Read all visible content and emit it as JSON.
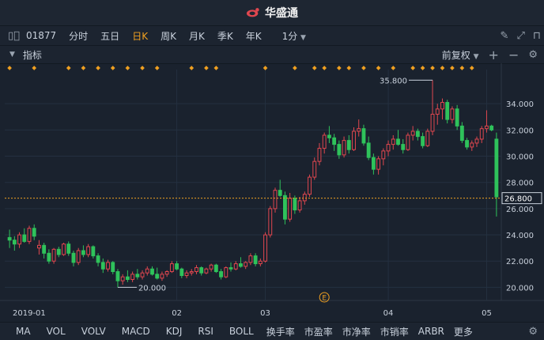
{
  "app": {
    "title": "华盛通"
  },
  "toolbar": {
    "stock_code": "01877",
    "periods": [
      "分时",
      "五日",
      "日K",
      "周K",
      "月K",
      "季K",
      "年K"
    ],
    "active_period": "日K",
    "interval": "1分",
    "icons": [
      "edit-icon",
      "fullscreen-icon",
      "layout-icon"
    ]
  },
  "indicator_bar": {
    "label": "指标",
    "adjust": "前复权",
    "add_icon": "plus-icon",
    "minus_icon": "minus-icon",
    "settings_icon": "gear-icon"
  },
  "bottom_tabs": [
    "MA",
    "VOL",
    "VOLV",
    "MACD",
    "KDJ",
    "RSI",
    "BOLL",
    "换手率",
    "市盈率",
    "市净率",
    "市销率",
    "ARBR",
    "更多"
  ],
  "colors": {
    "up": "#e0474f",
    "down": "#2fc25b",
    "marker": "#f0a020",
    "background": "#1a222e",
    "current_line": "#f0a020"
  },
  "chart_data": {
    "type": "candlestick",
    "x_labels": [
      "2019-01",
      "02",
      "03",
      "04",
      "05"
    ],
    "y_ticks": [
      20.0,
      22.0,
      24.0,
      26.0,
      28.0,
      30.0,
      32.0,
      34.0
    ],
    "ylim": [
      19.0,
      36.0
    ],
    "current_price": "26.800",
    "high_label": "35.800",
    "low_label": "20.000",
    "event_marker": "E",
    "candles": [
      [
        23.8,
        24.4,
        23.0,
        23.6
      ],
      [
        23.6,
        23.9,
        22.8,
        23.3
      ],
      [
        23.3,
        24.2,
        23.0,
        24.0
      ],
      [
        24.0,
        24.5,
        23.4,
        23.5
      ],
      [
        23.5,
        24.7,
        23.3,
        24.5
      ],
      [
        24.5,
        24.8,
        23.6,
        23.9
      ],
      [
        23.0,
        23.6,
        22.5,
        23.2
      ],
      [
        23.2,
        23.4,
        22.2,
        22.6
      ],
      [
        22.6,
        22.9,
        21.8,
        22.0
      ],
      [
        22.0,
        23.0,
        21.8,
        22.9
      ],
      [
        22.9,
        23.1,
        22.3,
        22.5
      ],
      [
        22.5,
        23.4,
        22.4,
        23.3
      ],
      [
        23.3,
        23.5,
        22.4,
        22.6
      ],
      [
        22.6,
        22.8,
        21.6,
        21.9
      ],
      [
        21.9,
        23.0,
        21.7,
        22.8
      ],
      [
        22.8,
        23.2,
        22.3,
        22.5
      ],
      [
        22.5,
        23.3,
        22.3,
        23.1
      ],
      [
        23.1,
        23.2,
        22.2,
        22.4
      ],
      [
        22.4,
        22.6,
        21.6,
        21.9
      ],
      [
        21.9,
        22.2,
        21.1,
        21.4
      ],
      [
        21.4,
        22.1,
        21.2,
        21.9
      ],
      [
        21.9,
        22.0,
        21.0,
        21.2
      ],
      [
        21.2,
        21.4,
        20.0,
        20.5
      ],
      [
        20.5,
        21.0,
        20.2,
        20.8
      ],
      [
        20.8,
        21.3,
        20.4,
        20.6
      ],
      [
        20.6,
        21.2,
        20.4,
        21.0
      ],
      [
        21.0,
        21.4,
        20.6,
        20.8
      ],
      [
        20.8,
        21.3,
        20.6,
        21.1
      ],
      [
        21.1,
        21.6,
        20.9,
        21.4
      ],
      [
        21.4,
        21.6,
        20.9,
        21.0
      ],
      [
        21.0,
        21.5,
        20.6,
        20.7
      ],
      [
        20.7,
        21.2,
        20.5,
        21.0
      ],
      [
        21.0,
        21.3,
        20.8,
        21.2
      ],
      [
        21.2,
        22.0,
        21.1,
        21.8
      ],
      [
        21.8,
        22.0,
        21.3,
        21.4
      ],
      [
        21.4,
        21.5,
        20.7,
        20.9
      ],
      [
        20.9,
        21.3,
        20.7,
        21.1
      ],
      [
        21.1,
        21.4,
        20.9,
        21.2
      ],
      [
        21.2,
        21.7,
        21.0,
        21.5
      ],
      [
        21.5,
        21.6,
        20.9,
        21.1
      ],
      [
        21.1,
        21.5,
        21.0,
        21.4
      ],
      [
        21.4,
        21.8,
        21.2,
        21.7
      ],
      [
        21.7,
        21.8,
        21.1,
        21.2
      ],
      [
        21.2,
        21.4,
        20.6,
        20.8
      ],
      [
        20.8,
        21.6,
        20.7,
        21.5
      ],
      [
        21.5,
        21.9,
        21.2,
        21.4
      ],
      [
        21.4,
        22.0,
        21.3,
        21.8
      ],
      [
        21.8,
        22.3,
        21.5,
        21.6
      ],
      [
        21.6,
        22.0,
        21.4,
        21.9
      ],
      [
        21.9,
        22.6,
        21.7,
        22.4
      ],
      [
        22.4,
        22.6,
        21.6,
        21.8
      ],
      [
        21.8,
        22.2,
        21.6,
        22.0
      ],
      [
        22.0,
        24.2,
        21.9,
        24.0
      ],
      [
        24.0,
        26.2,
        23.8,
        26.0
      ],
      [
        26.0,
        27.6,
        25.7,
        27.4
      ],
      [
        27.4,
        28.2,
        26.9,
        27.0
      ],
      [
        27.0,
        27.3,
        24.8,
        25.2
      ],
      [
        25.2,
        27.2,
        25.0,
        26.8
      ],
      [
        26.8,
        27.0,
        25.6,
        25.9
      ],
      [
        25.9,
        26.9,
        25.7,
        26.6
      ],
      [
        26.6,
        27.3,
        26.3,
        27.1
      ],
      [
        27.1,
        28.6,
        26.9,
        28.4
      ],
      [
        28.4,
        29.9,
        28.2,
        29.6
      ],
      [
        29.6,
        31.0,
        29.3,
        30.6
      ],
      [
        30.6,
        31.8,
        30.2,
        31.6
      ],
      [
        31.6,
        32.3,
        31.0,
        31.4
      ],
      [
        31.4,
        31.7,
        30.4,
        30.9
      ],
      [
        30.9,
        31.2,
        29.8,
        30.1
      ],
      [
        30.1,
        31.5,
        29.9,
        31.2
      ],
      [
        31.2,
        31.6,
        30.2,
        30.5
      ],
      [
        30.5,
        32.2,
        30.4,
        31.9
      ],
      [
        31.9,
        32.8,
        31.5,
        32.1
      ],
      [
        32.1,
        32.4,
        30.8,
        31.0
      ],
      [
        31.0,
        31.5,
        29.7,
        29.9
      ],
      [
        29.9,
        30.2,
        28.6,
        29.0
      ],
      [
        29.0,
        30.0,
        28.6,
        29.8
      ],
      [
        29.8,
        30.6,
        29.3,
        30.4
      ],
      [
        30.4,
        31.2,
        30.0,
        30.9
      ],
      [
        30.9,
        31.6,
        30.5,
        31.3
      ],
      [
        31.3,
        32.0,
        30.8,
        30.9
      ],
      [
        30.9,
        31.3,
        30.2,
        30.5
      ],
      [
        30.5,
        31.8,
        30.4,
        31.6
      ],
      [
        31.6,
        32.3,
        31.2,
        31.9
      ],
      [
        31.9,
        32.1,
        31.2,
        31.5
      ],
      [
        31.5,
        31.8,
        30.6,
        30.8
      ],
      [
        30.8,
        32.1,
        30.7,
        31.9
      ],
      [
        31.9,
        35.8,
        31.6,
        33.2
      ],
      [
        33.2,
        34.0,
        32.4,
        33.6
      ],
      [
        33.6,
        34.4,
        32.8,
        34.1
      ],
      [
        34.1,
        34.3,
        32.5,
        32.8
      ],
      [
        32.8,
        33.8,
        32.5,
        33.6
      ],
      [
        33.6,
        33.9,
        32.0,
        32.3
      ],
      [
        32.3,
        32.6,
        31.0,
        31.2
      ],
      [
        31.2,
        31.4,
        30.5,
        30.7
      ],
      [
        30.7,
        31.2,
        30.4,
        31.0
      ],
      [
        31.0,
        31.5,
        30.7,
        31.3
      ],
      [
        31.3,
        32.3,
        31.0,
        32.1
      ],
      [
        32.1,
        33.5,
        31.8,
        32.3
      ],
      [
        32.3,
        32.4,
        31.9,
        32.0
      ],
      [
        31.3,
        31.8,
        25.4,
        26.9
      ]
    ]
  }
}
